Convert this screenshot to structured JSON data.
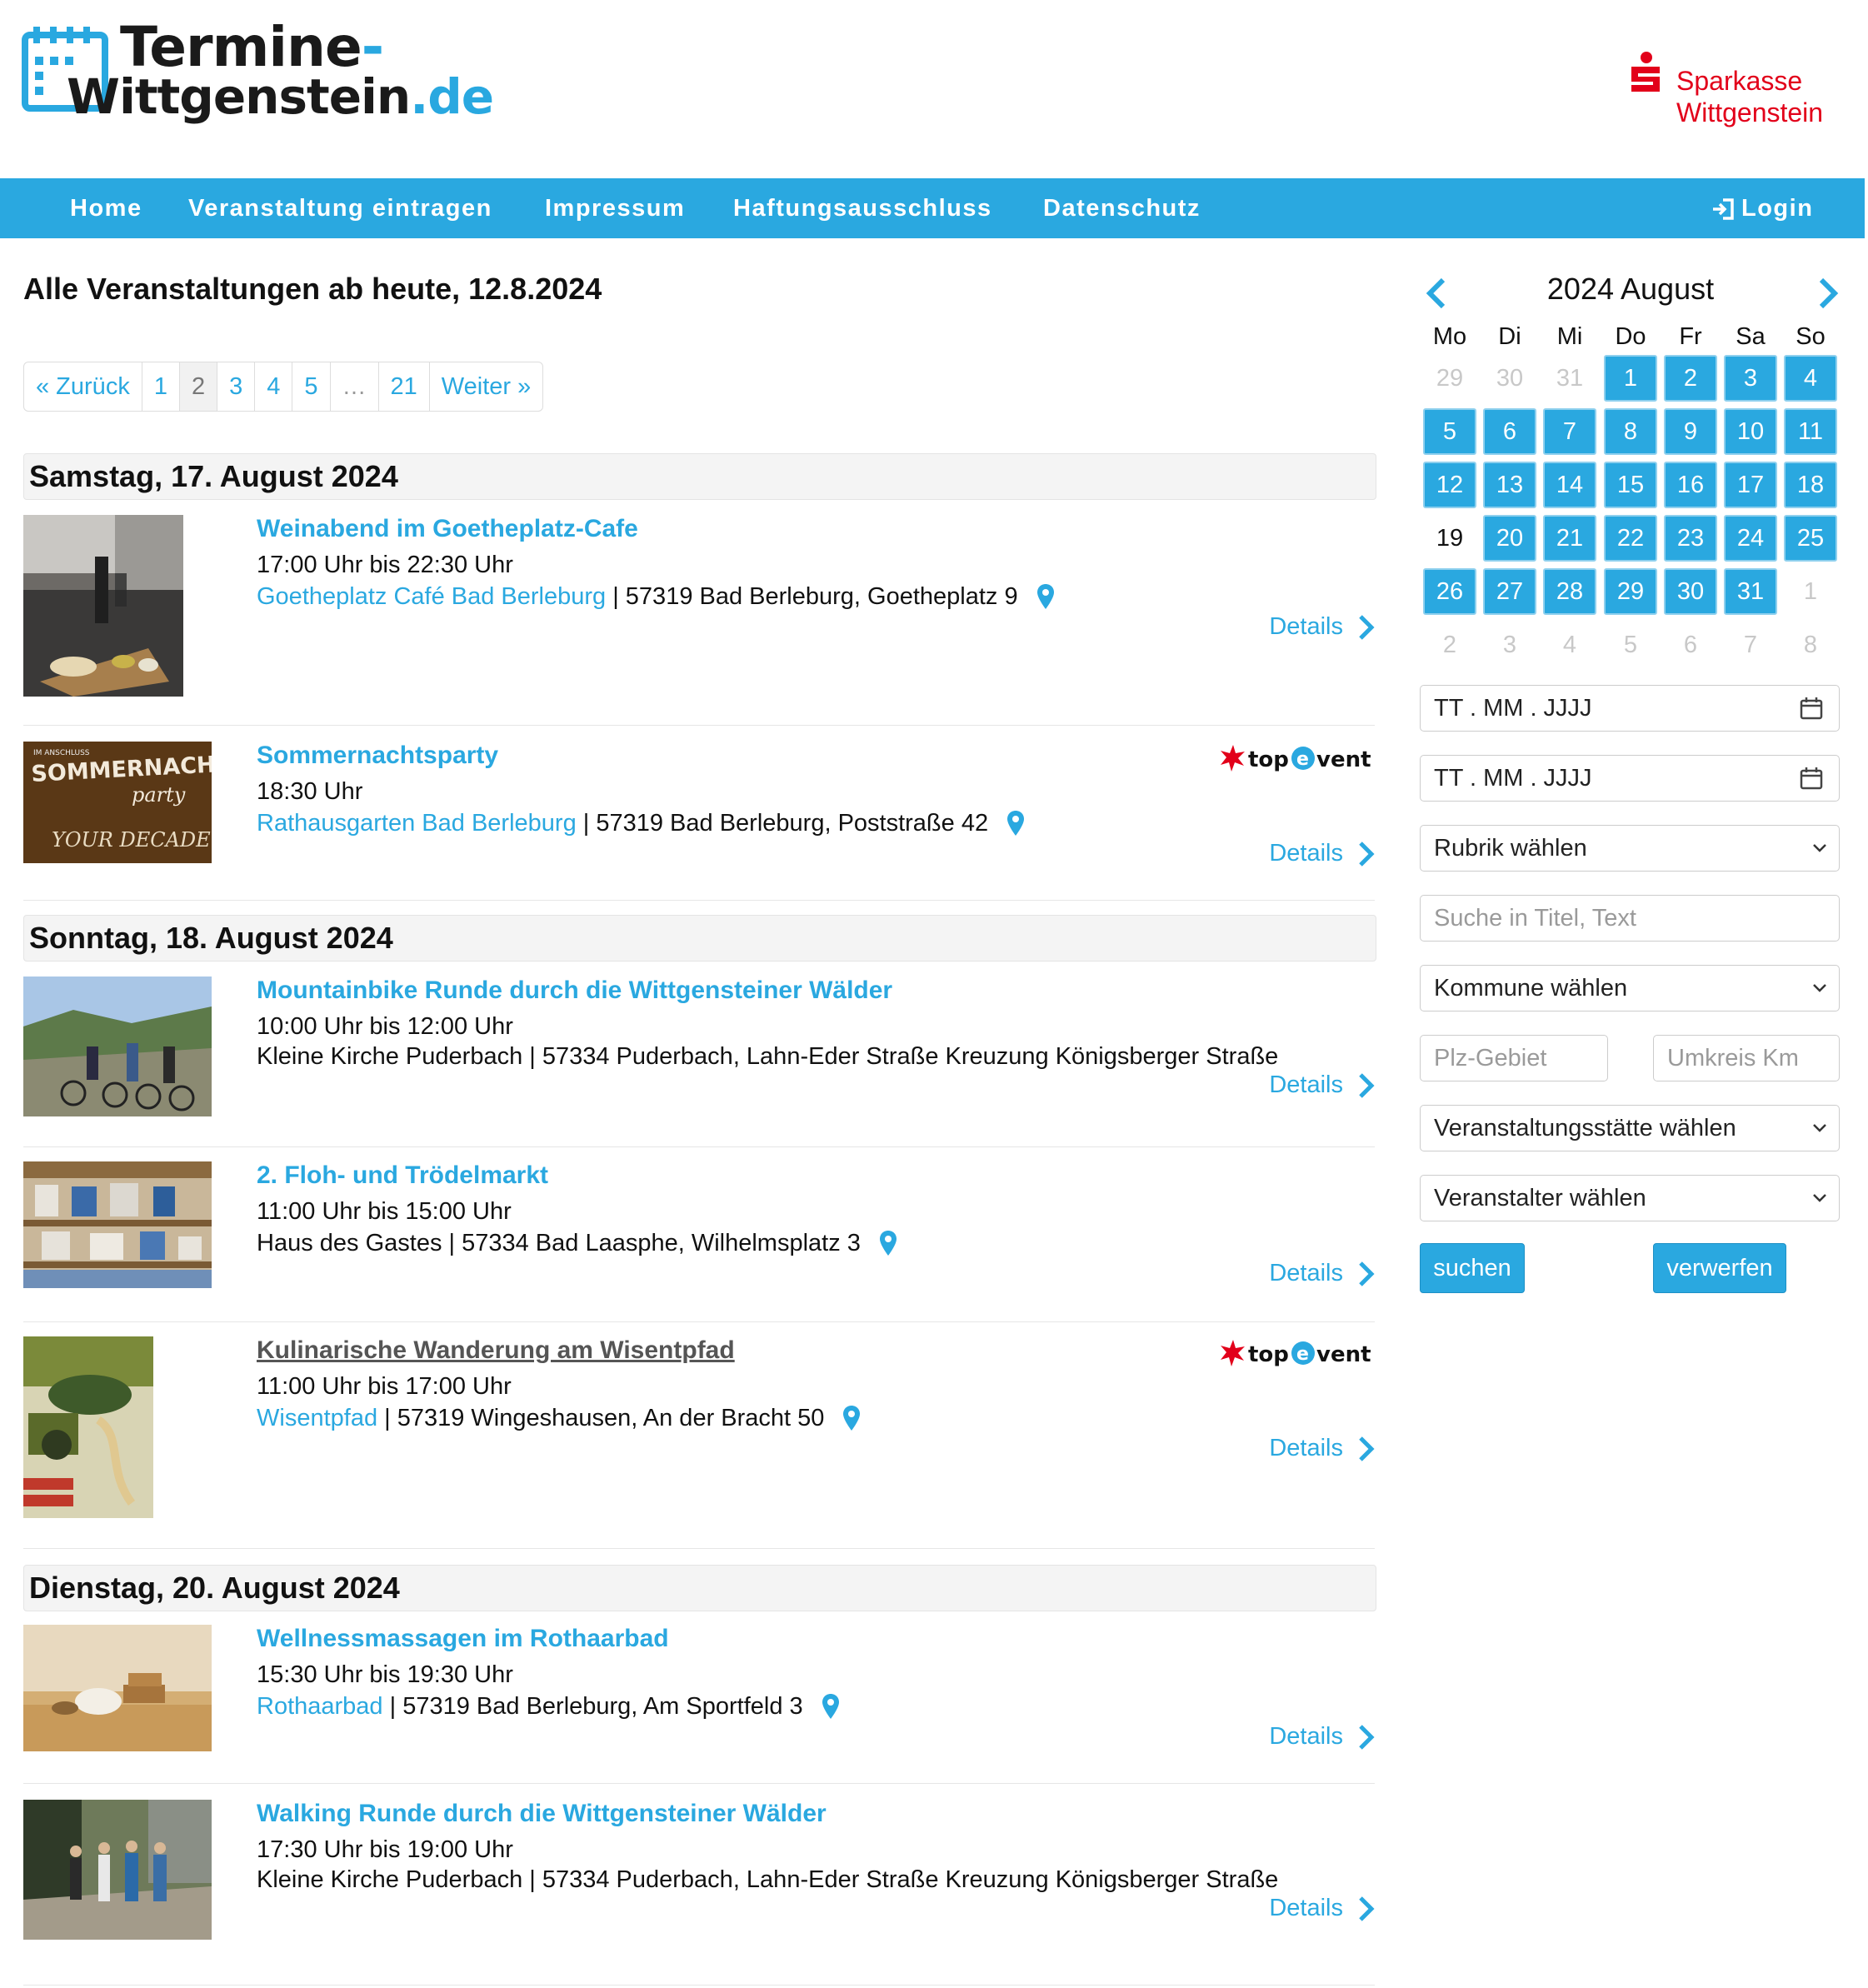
{
  "brand": {
    "logo_line1": "Termine",
    "logo_dash": "-",
    "logo_line2": "Wittgenstein",
    "logo_tld": ".de",
    "sponsor_line1": "Sparkasse",
    "sponsor_line2": "Wittgenstein",
    "accent_color": "#2aa8e0",
    "sponsor_color": "#e2001a"
  },
  "nav": {
    "items": [
      "Home",
      "Veranstaltung eintragen",
      "Impressum",
      "Haftungsausschluss",
      "Datenschutz"
    ],
    "login": "Login"
  },
  "main": {
    "title": "Alle Veranstaltungen ab heute, 12.8.2024",
    "pagination": [
      "« Zurück",
      "1",
      "2",
      "3",
      "4",
      "5",
      "…",
      "21",
      "Weiter »"
    ],
    "pagination_active": "2",
    "details_label": "Details",
    "days": [
      {
        "label": "Samstag, 17. August 2024",
        "events": [
          {
            "title": "Weinabend im Goetheplatz-Cafe",
            "time": "17:00 Uhr bis 22:30 Uhr",
            "venue": "Goetheplatz Café Bad Berleburg",
            "address": " | 57319 Bad Berleburg, Goetheplatz 9",
            "pin": true,
            "topevent": false,
            "image": "wine-and-bread-photo"
          },
          {
            "title": "Sommernachtsparty",
            "time": "18:30 Uhr",
            "venue": "Rathausgarten Bad Berleburg",
            "address": " | 57319 Bad Berleburg, Poststraße 42",
            "pin": true,
            "topevent": true,
            "image": "party-poster",
            "poster_text": [
              "IM ANSCHLUSS",
              "SOMMERNACHTS",
              "party",
              "YOUR DECADE"
            ]
          }
        ]
      },
      {
        "label": "Sonntag, 18. August 2024",
        "events": [
          {
            "title": "Mountainbike Runde durch die Wittgensteiner Wälder",
            "time": "10:00 Uhr bis 12:00 Uhr",
            "venue": "",
            "address": "Kleine Kirche Puderbach | 57334 Puderbach, Lahn-Eder Straße Kreuzung Königsberger Straße",
            "pin": false,
            "topevent": false,
            "image": "cyclists-photo"
          },
          {
            "title": "2. Floh- und Trödelmarkt",
            "time": "11:00 Uhr bis 15:00 Uhr",
            "venue": "",
            "address": "Haus des Gastes | 57334 Bad Laasphe, Wilhelmsplatz 3",
            "pin": true,
            "topevent": false,
            "image": "flea-market-photo"
          },
          {
            "title": "Kulinarische Wanderung am Wisentpfad",
            "time": "11:00 Uhr bis 17:00 Uhr",
            "venue": "Wisentpfad",
            "address": " | 57319 Wingeshausen, An der Bracht 50",
            "pin": true,
            "topevent": true,
            "image": "hiking-flyer"
          }
        ]
      },
      {
        "label": "Dienstag, 20. August 2024",
        "events": [
          {
            "title": "Wellnessmassagen im Rothaarbad",
            "time": "15:30 Uhr bis 19:30 Uhr",
            "venue": "Rothaarbad",
            "address": " | 57319 Bad Berleburg, Am Sportfeld 3",
            "pin": true,
            "topevent": false,
            "image": "wellness-photo"
          },
          {
            "title": "Walking Runde durch die Wittgensteiner Wälder",
            "time": "17:30 Uhr bis 19:00 Uhr",
            "venue": "",
            "address": "Kleine Kirche Puderbach | 57334 Puderbach, Lahn-Eder Straße Kreuzung Königsberger Straße",
            "pin": false,
            "topevent": false,
            "image": "walkers-photo"
          }
        ]
      }
    ],
    "topevent_label": "top event"
  },
  "calendar": {
    "title": "2024 August",
    "weekdays": [
      "Mo",
      "Di",
      "Mi",
      "Do",
      "Fr",
      "Sa",
      "So"
    ],
    "weeks": [
      [
        "29",
        "30",
        "31",
        "1",
        "2",
        "3",
        "4"
      ],
      [
        "5",
        "6",
        "7",
        "8",
        "9",
        "10",
        "11"
      ],
      [
        "12",
        "13",
        "14",
        "15",
        "16",
        "17",
        "18"
      ],
      [
        "19",
        "20",
        "21",
        "22",
        "23",
        "24",
        "25"
      ],
      [
        "26",
        "27",
        "28",
        "29",
        "30",
        "31",
        "1"
      ],
      [
        "2",
        "3",
        "4",
        "5",
        "6",
        "7",
        "8"
      ]
    ],
    "cell_states": [
      [
        "off",
        "off",
        "off",
        "on",
        "on",
        "on",
        "on"
      ],
      [
        "on",
        "on",
        "on",
        "on",
        "on",
        "on",
        "on"
      ],
      [
        "on",
        "on",
        "on",
        "on",
        "on",
        "on",
        "on"
      ],
      [
        "today",
        "on",
        "on",
        "on",
        "on",
        "on",
        "on"
      ],
      [
        "on",
        "on",
        "on",
        "on",
        "on",
        "on",
        "off"
      ],
      [
        "off",
        "off",
        "off",
        "off",
        "off",
        "off",
        "off"
      ]
    ]
  },
  "filters": {
    "date_from_placeholder": "TT . MM . JJJJ",
    "date_to_placeholder": "TT . MM . JJJJ",
    "category": "Rubrik wählen",
    "search_placeholder": "Suche in Titel, Text",
    "municipality": "Kommune wählen",
    "zip_placeholder": "Plz-Gebiet",
    "radius_placeholder": "Umkreis Km",
    "venue": "Veranstaltungsstätte wählen",
    "organizer": "Veranstalter wählen",
    "search_button": "suchen",
    "reset_button": "verwerfen"
  }
}
